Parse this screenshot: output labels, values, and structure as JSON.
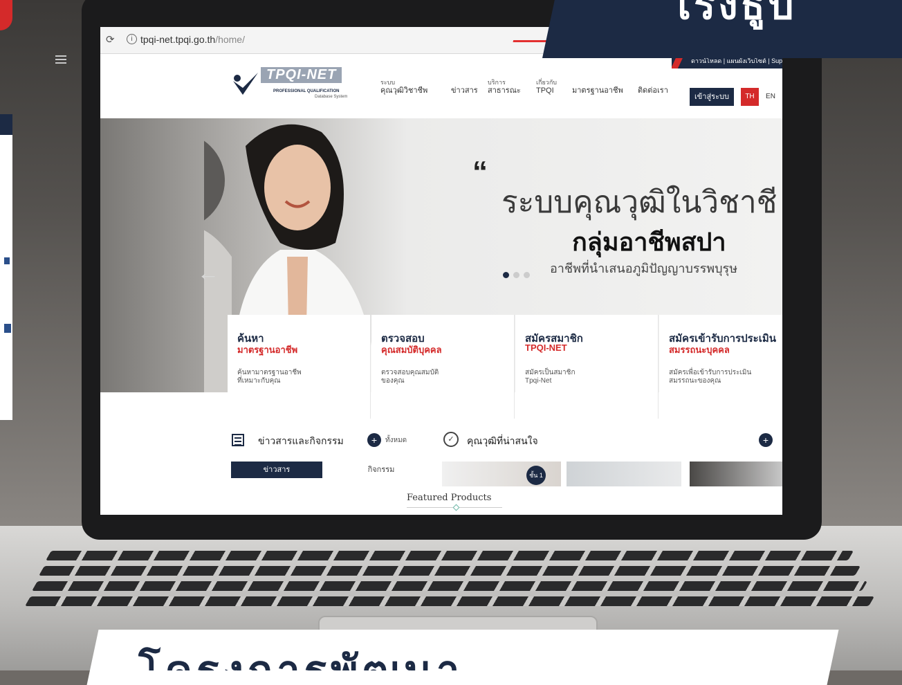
{
  "browser": {
    "url_host": "tpqi-net.tpqi.go.th",
    "url_path": "/home/",
    "reload_icon": "reload-icon",
    "info_icon": "info-icon"
  },
  "site": {
    "top_links": "ดาวน์โหลด | แผนผังเว็บไซต์ | Sup",
    "logo": {
      "brand": "TPQI-NET",
      "line1": "PROFESSIONAL QUALIFICATION",
      "line2": "Database System"
    },
    "nav": [
      {
        "small": "ระบบ",
        "label": "คุณวุฒิวิชาชีพ"
      },
      {
        "small": "",
        "label": "ข่าวสาร"
      },
      {
        "small": "บริการ",
        "label": "สาธารณะ"
      },
      {
        "small": "เกี่ยวกับ",
        "label": "TPQI"
      },
      {
        "small": "",
        "label": "มาตรฐานอาชีพ"
      },
      {
        "small": "",
        "label": "ติดต่อเรา"
      }
    ],
    "login_label": "เข้าสู่ระบบ",
    "lang_th": "TH",
    "lang_en": "EN",
    "hero": {
      "quote": "“",
      "headline": "ระบบคุณวุฒิในวิชาชี",
      "subheadline": "กลุ่มอาชีพสปา",
      "caption": "อาชีพที่นำเสนอภูมิปัญญาบรรพบุรุษ"
    },
    "cards": [
      {
        "title": "ค้นหา",
        "subtitle": "มาตรฐานอาชีพ",
        "desc1": "ค้นหามาตรฐานอาชีพ",
        "desc2": "ที่เหมาะกับคุณ"
      },
      {
        "title": "ตรวจสอบ",
        "subtitle": "คุณสมบัติบุคคล",
        "desc1": "ตรวจสอบคุณสมบัติ",
        "desc2": "ของคุณ"
      },
      {
        "title": "สมัครสมาชิก",
        "subtitle": "TPQI-NET",
        "desc1": "สมัครเป็นสมาชิก",
        "desc2": "Tpqi-Net"
      },
      {
        "title": "สมัครเข้ารับการประเมิน",
        "subtitle": "สมรรถนะบุคคล",
        "desc1": "สมัครเพื่อเข้ารับการประเมิน",
        "desc2": "สมรรถนะของคุณ"
      }
    ],
    "news": {
      "section1_label": "ข่าวสารและกิจกรรม",
      "section1_all": "ทั้งหมด",
      "section2_label": "คุณวุฒิที่น่าสนใจ",
      "tab_news": "ข่าวสาร",
      "tab_activity": "กิจกรรม",
      "level_badge": "ชั้น 1"
    },
    "featured_label": "Featured Products"
  },
  "overlay": {
    "top_text": "โรงธูป",
    "bottom_text": "โครงการพัฒนา"
  },
  "colors": {
    "navy": "#1c2a44",
    "red": "#d42a2a"
  }
}
